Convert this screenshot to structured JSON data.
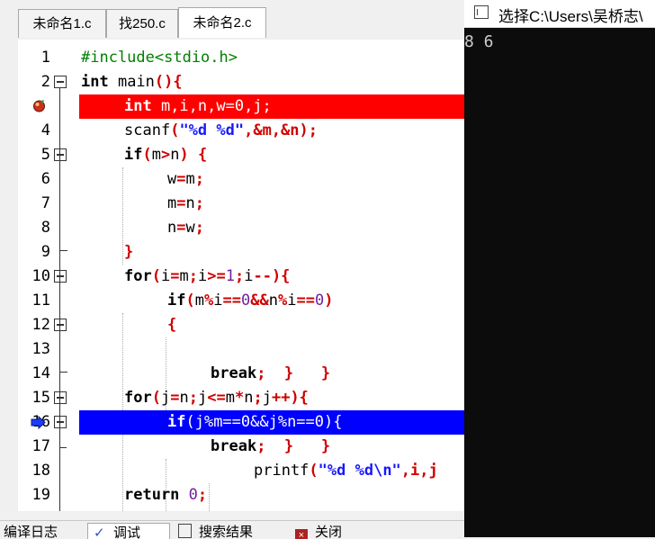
{
  "editor_tabs": [
    {
      "label": "未命名1.c",
      "active": false
    },
    {
      "label": "找250.c",
      "active": false
    },
    {
      "label": "未命名2.c",
      "active": true
    }
  ],
  "code_lines": [
    {
      "n": "1"
    },
    {
      "n": "2"
    },
    {
      "n": "3"
    },
    {
      "n": "4"
    },
    {
      "n": "5"
    },
    {
      "n": "6"
    },
    {
      "n": "7"
    },
    {
      "n": "8"
    },
    {
      "n": "9"
    },
    {
      "n": "10"
    },
    {
      "n": "11"
    },
    {
      "n": "12"
    },
    {
      "n": "13"
    },
    {
      "n": "14"
    },
    {
      "n": "15"
    },
    {
      "n": "16"
    },
    {
      "n": "17"
    },
    {
      "n": "18"
    },
    {
      "n": "19"
    }
  ],
  "code": {
    "l1": {
      "pp": "#include<stdio.h>"
    },
    "l2": {
      "kw": "int",
      "name": " main",
      "p": "(){"
    },
    "l3": {
      "kw": "int",
      "rest": " m,i,n,w=0,j;"
    },
    "l4": {
      "fn": "scanf",
      "p1": "(",
      "str": "\"%d %d\"",
      "p2": ",&m,&n);"
    },
    "l5": {
      "kw": "if",
      "p1": "(",
      "a": "m",
      "op": ">",
      "b": "n",
      "p2": ") {"
    },
    "l6": {
      "a": "w",
      "op": "=",
      "b": "m",
      "p": ";"
    },
    "l7": {
      "a": "m",
      "op": "=",
      "b": "n",
      "p": ";"
    },
    "l8": {
      "a": "n",
      "op": "=",
      "b": "w",
      "p": ";"
    },
    "l9": {
      "p": "}"
    },
    "l10": {
      "kw": "for",
      "p1": "(",
      "a": "i",
      "op1": "=",
      "b": "m",
      "s1": ";",
      "c": "i",
      "op2": ">=",
      "d": "1",
      "s2": ";",
      "e": "i",
      "op3": "--",
      "p2": "){"
    },
    "l11": {
      "kw": "if",
      "p1": "(",
      "a": "m",
      "op1": "%",
      "b": "i",
      "op2": "==",
      "c": "0",
      "op3": "&&",
      "d": "n",
      "op4": "%",
      "e": "i",
      "op5": "==",
      "f": "0",
      "p2": ")"
    },
    "l12": {
      "p": "{"
    },
    "l14": {
      "kw": "break",
      "p1": ";",
      "p2": "}",
      "p3": "}"
    },
    "l15": {
      "kw": "for",
      "p1": "(",
      "a": "j",
      "op1": "=",
      "b": "n",
      "s1": ";",
      "c": "j",
      "op2": "<=",
      "d": "m",
      "op3": "*",
      "e": "n",
      "s2": ";",
      "f": "j",
      "op4": "++",
      "p2": "){"
    },
    "l16": {
      "kw": "if",
      "rest": "(j%m==0&&j%n==0){"
    },
    "l17": {
      "kw": "break",
      "p1": ";",
      "p2": "}",
      "p3": "}"
    },
    "l18": {
      "fn": "printf",
      "p1": "(",
      "str": "\"%d %d\\n\"",
      "p2": ",i,j"
    },
    "l19": {
      "kw": "return",
      "num": " 0",
      "p": ";"
    }
  },
  "bottom_tabs": [
    {
      "label": "编译日志"
    },
    {
      "label": "调试"
    },
    {
      "label": "搜索结果"
    },
    {
      "label": "关闭"
    }
  ],
  "console": {
    "title": "选择C:\\Users\\吴桥志\\",
    "output": "8 6"
  },
  "colors": {
    "breakpoint_line": "#ff0000",
    "execution_line": "#0000ff",
    "console_bg": "#0c0c0c"
  }
}
